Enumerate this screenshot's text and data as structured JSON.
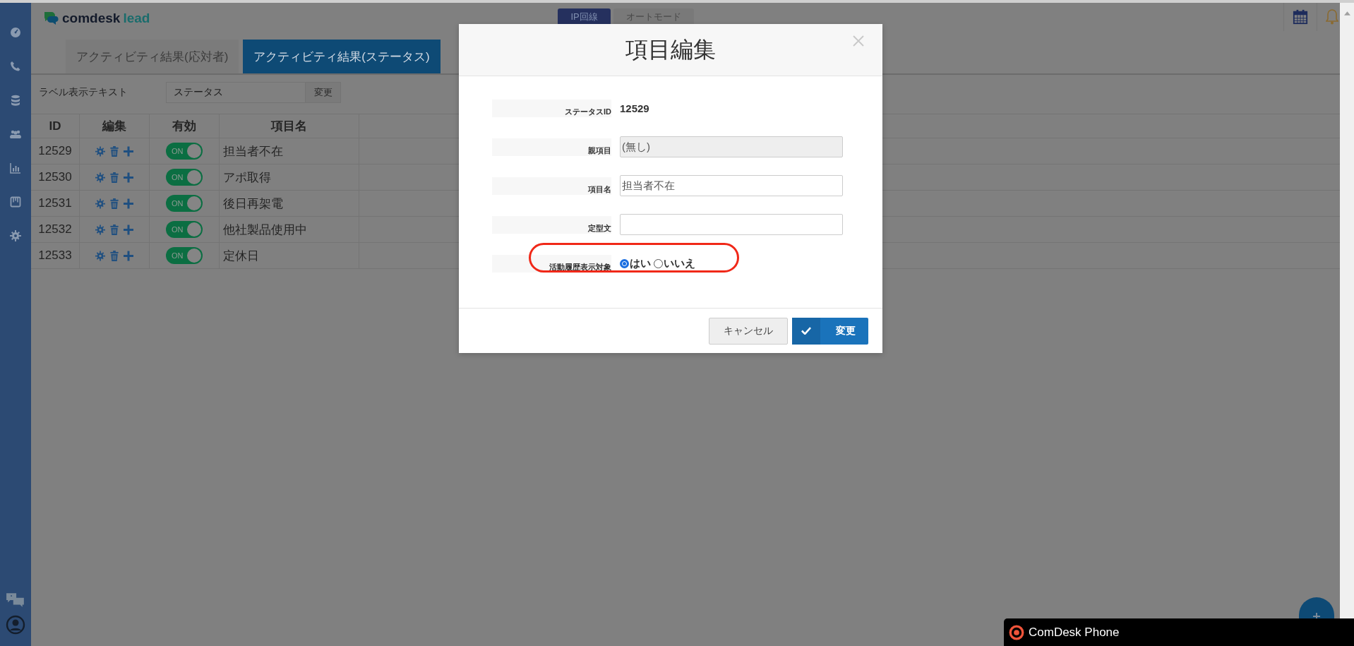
{
  "header": {
    "brand": "comdesk",
    "product": "lead"
  },
  "line_modes": [
    {
      "label": "IP回線",
      "selected": true
    },
    {
      "label": "オートモード",
      "selected": false
    }
  ],
  "tabs": [
    {
      "label": "アクティビティ結果(応対者)",
      "selected": false
    },
    {
      "label": "アクティビティ結果(ステータス)",
      "selected": true
    }
  ],
  "label_setting": {
    "label": "ラベル表示テキスト",
    "value": "ステータス",
    "button": "変更"
  },
  "table": {
    "columns": [
      "ID",
      "編集",
      "有効",
      "項目名"
    ],
    "rows": [
      {
        "id": "12529",
        "enabled": true,
        "toggle_label": "ON",
        "name": "担当者不在"
      },
      {
        "id": "12530",
        "enabled": true,
        "toggle_label": "ON",
        "name": "アポ取得"
      },
      {
        "id": "12531",
        "enabled": true,
        "toggle_label": "ON",
        "name": "後日再架電"
      },
      {
        "id": "12532",
        "enabled": true,
        "toggle_label": "ON",
        "name": "他社製品使用中"
      },
      {
        "id": "12533",
        "enabled": true,
        "toggle_label": "ON",
        "name": "定休日"
      }
    ]
  },
  "modal": {
    "title": "項目編集",
    "fields": [
      {
        "kind": "text",
        "label": "ステータスID",
        "value": "12529"
      },
      {
        "kind": "input",
        "label": "親項目",
        "value": "(無し)",
        "disabled": true
      },
      {
        "kind": "input",
        "label": "項目名",
        "value": "担当者不在",
        "disabled": false
      },
      {
        "kind": "input",
        "label": "定型文",
        "disabled": false
      },
      {
        "kind": "radio",
        "label": "活動履歴表示対象",
        "highlighted": true,
        "options": [
          {
            "label": "はい",
            "selected": true
          },
          {
            "label": "いいえ",
            "selected": false
          }
        ]
      }
    ],
    "buttons": [
      {
        "kind": "cancel",
        "label": "キャンセル"
      },
      {
        "kind": "primary",
        "label": "変更"
      }
    ]
  },
  "phone_bar": {
    "title": "ComDesk Phone"
  }
}
